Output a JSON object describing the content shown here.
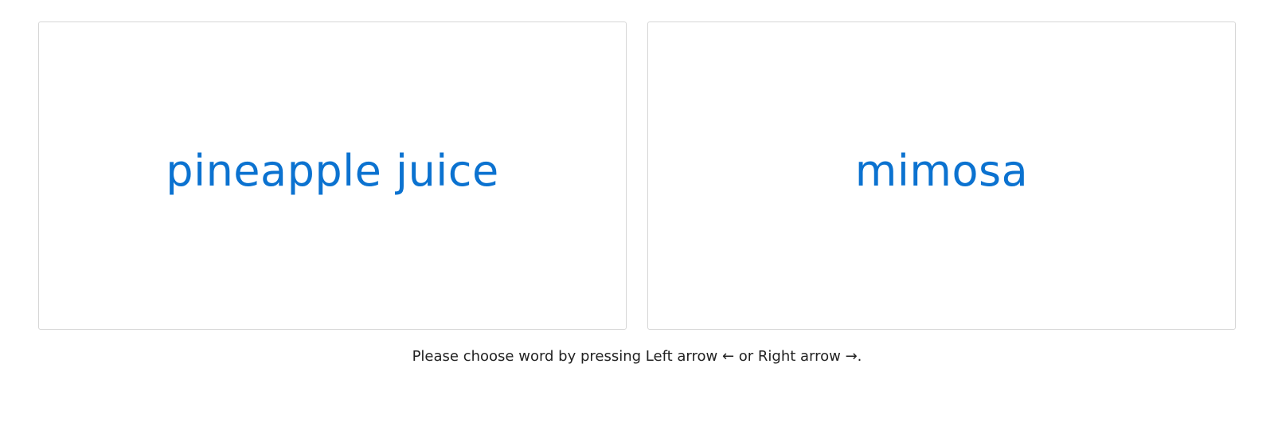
{
  "choices": {
    "left_word": "pineapple juice",
    "right_word": "mimosa"
  },
  "instruction": {
    "text": "Please choose word by pressing Left arrow ← or Right arrow →."
  },
  "colors": {
    "word": "#0b72d0",
    "card_border": "#d6d6d6",
    "text": "#222222",
    "background": "#ffffff"
  }
}
